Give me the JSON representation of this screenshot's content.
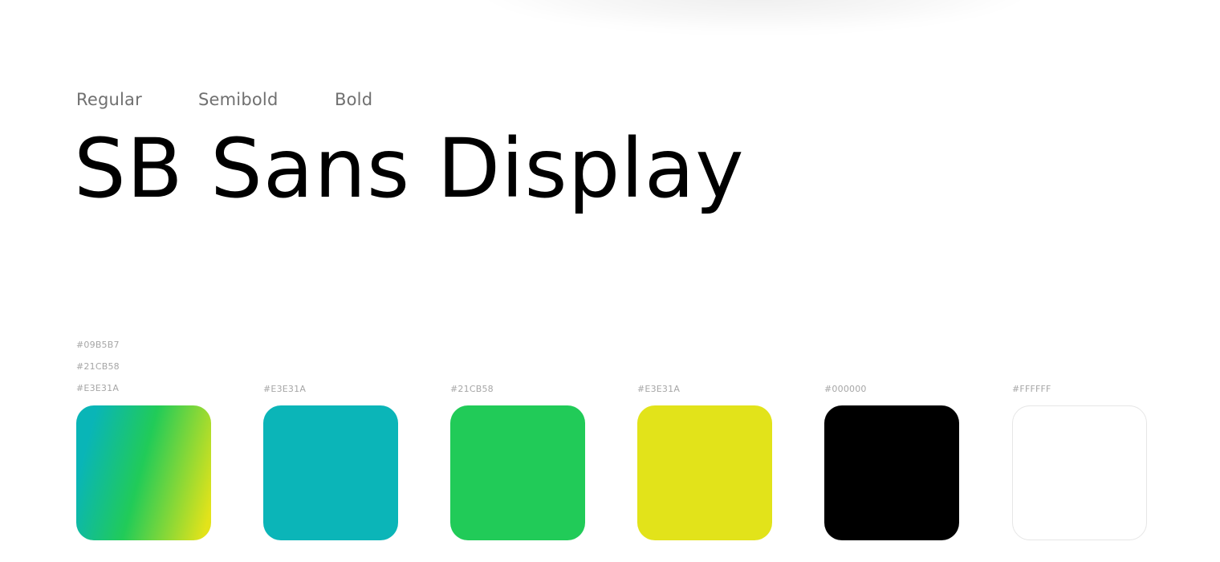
{
  "font": {
    "weights": [
      "Regular",
      "Semibold",
      "Bold"
    ],
    "name": "SB Sans Display"
  },
  "palette": {
    "gradient": {
      "stops": [
        "#09B5B7",
        "#21CB58",
        "#E3E31A"
      ]
    },
    "swatches": [
      {
        "label": "#E3E31A",
        "color": "#0BB5B8"
      },
      {
        "label": "#21CB58",
        "color": "#21CB58"
      },
      {
        "label": "#E3E31A",
        "color": "#E2E31A"
      },
      {
        "label": "#000000",
        "color": "#000000"
      },
      {
        "label": "#FFFFFF",
        "color": "#FFFFFF"
      }
    ]
  }
}
